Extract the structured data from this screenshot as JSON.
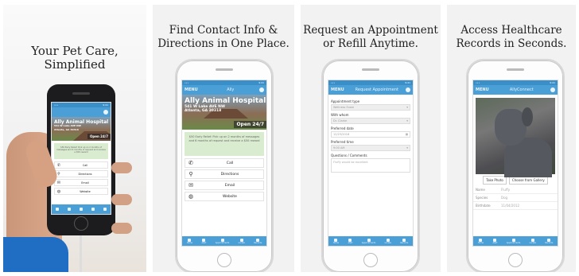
{
  "panels": [
    {
      "caption": [
        "Your Pet Care,",
        "Simplified"
      ],
      "app_title": "Ally Animal Hospital",
      "address": [
        "541 W Lake AVE NW",
        "Atlanta, GA 30318"
      ],
      "open_badge": "Open 24/7",
      "notice": "$50 Early Relief: Pick up on 2 months of messages and 6 months of request and receive a $50 reward",
      "actions": [
        "Call",
        "Directions",
        "Email",
        "Website"
      ]
    },
    {
      "caption": [
        "Find Contact Info &",
        "Directions in One Place."
      ],
      "menu": "MENU",
      "screen_title": "Ally",
      "app_title": "Ally Animal Hospital",
      "address": [
        "541 W Lake AVE NW",
        "Atlanta, GA 30318"
      ],
      "open_badge": "Open 24/7",
      "notice": "$50 Early Relief: Pick up on 2 months of messages and 6 months of request and receive a $50 reward",
      "actions": [
        "Call",
        "Directions",
        "Email",
        "Website"
      ],
      "tabs": [
        "Home",
        "Alert",
        "Appointments",
        "Locate",
        "Records"
      ]
    },
    {
      "caption": [
        "Request an Appointment",
        "or Refill Anytime."
      ],
      "menu": "MENU",
      "screen_title": "Request Appointment",
      "fields": [
        {
          "label": "Appointment type",
          "value": "Wellness Exam"
        },
        {
          "label": "With whom",
          "value": "Dr. Clarke"
        },
        {
          "label": "Preferred date",
          "value": "12/23/2016"
        },
        {
          "label": "Preferred time",
          "value": "9:00 AM"
        },
        {
          "label": "Questions / Comments",
          "value": "Fluffy would be excellent"
        }
      ],
      "tabs": [
        "Home",
        "Alert",
        "Appointments",
        "Locate",
        "Records"
      ]
    },
    {
      "caption": [
        "Access Healthcare",
        "Records in Seconds."
      ],
      "menu": "MENU",
      "screen_title": "AllyConnect",
      "photo_buttons": [
        "Take Photo",
        "Choose from Gallery"
      ],
      "records": [
        {
          "key": "Name",
          "value": "Fluffy"
        },
        {
          "key": "Species",
          "value": "Dog"
        },
        {
          "key": "Birthdate",
          "value": "11/04/2012"
        }
      ],
      "tabs": [
        "Home",
        "Alert",
        "Appointments",
        "Locate",
        "Records"
      ]
    }
  ]
}
